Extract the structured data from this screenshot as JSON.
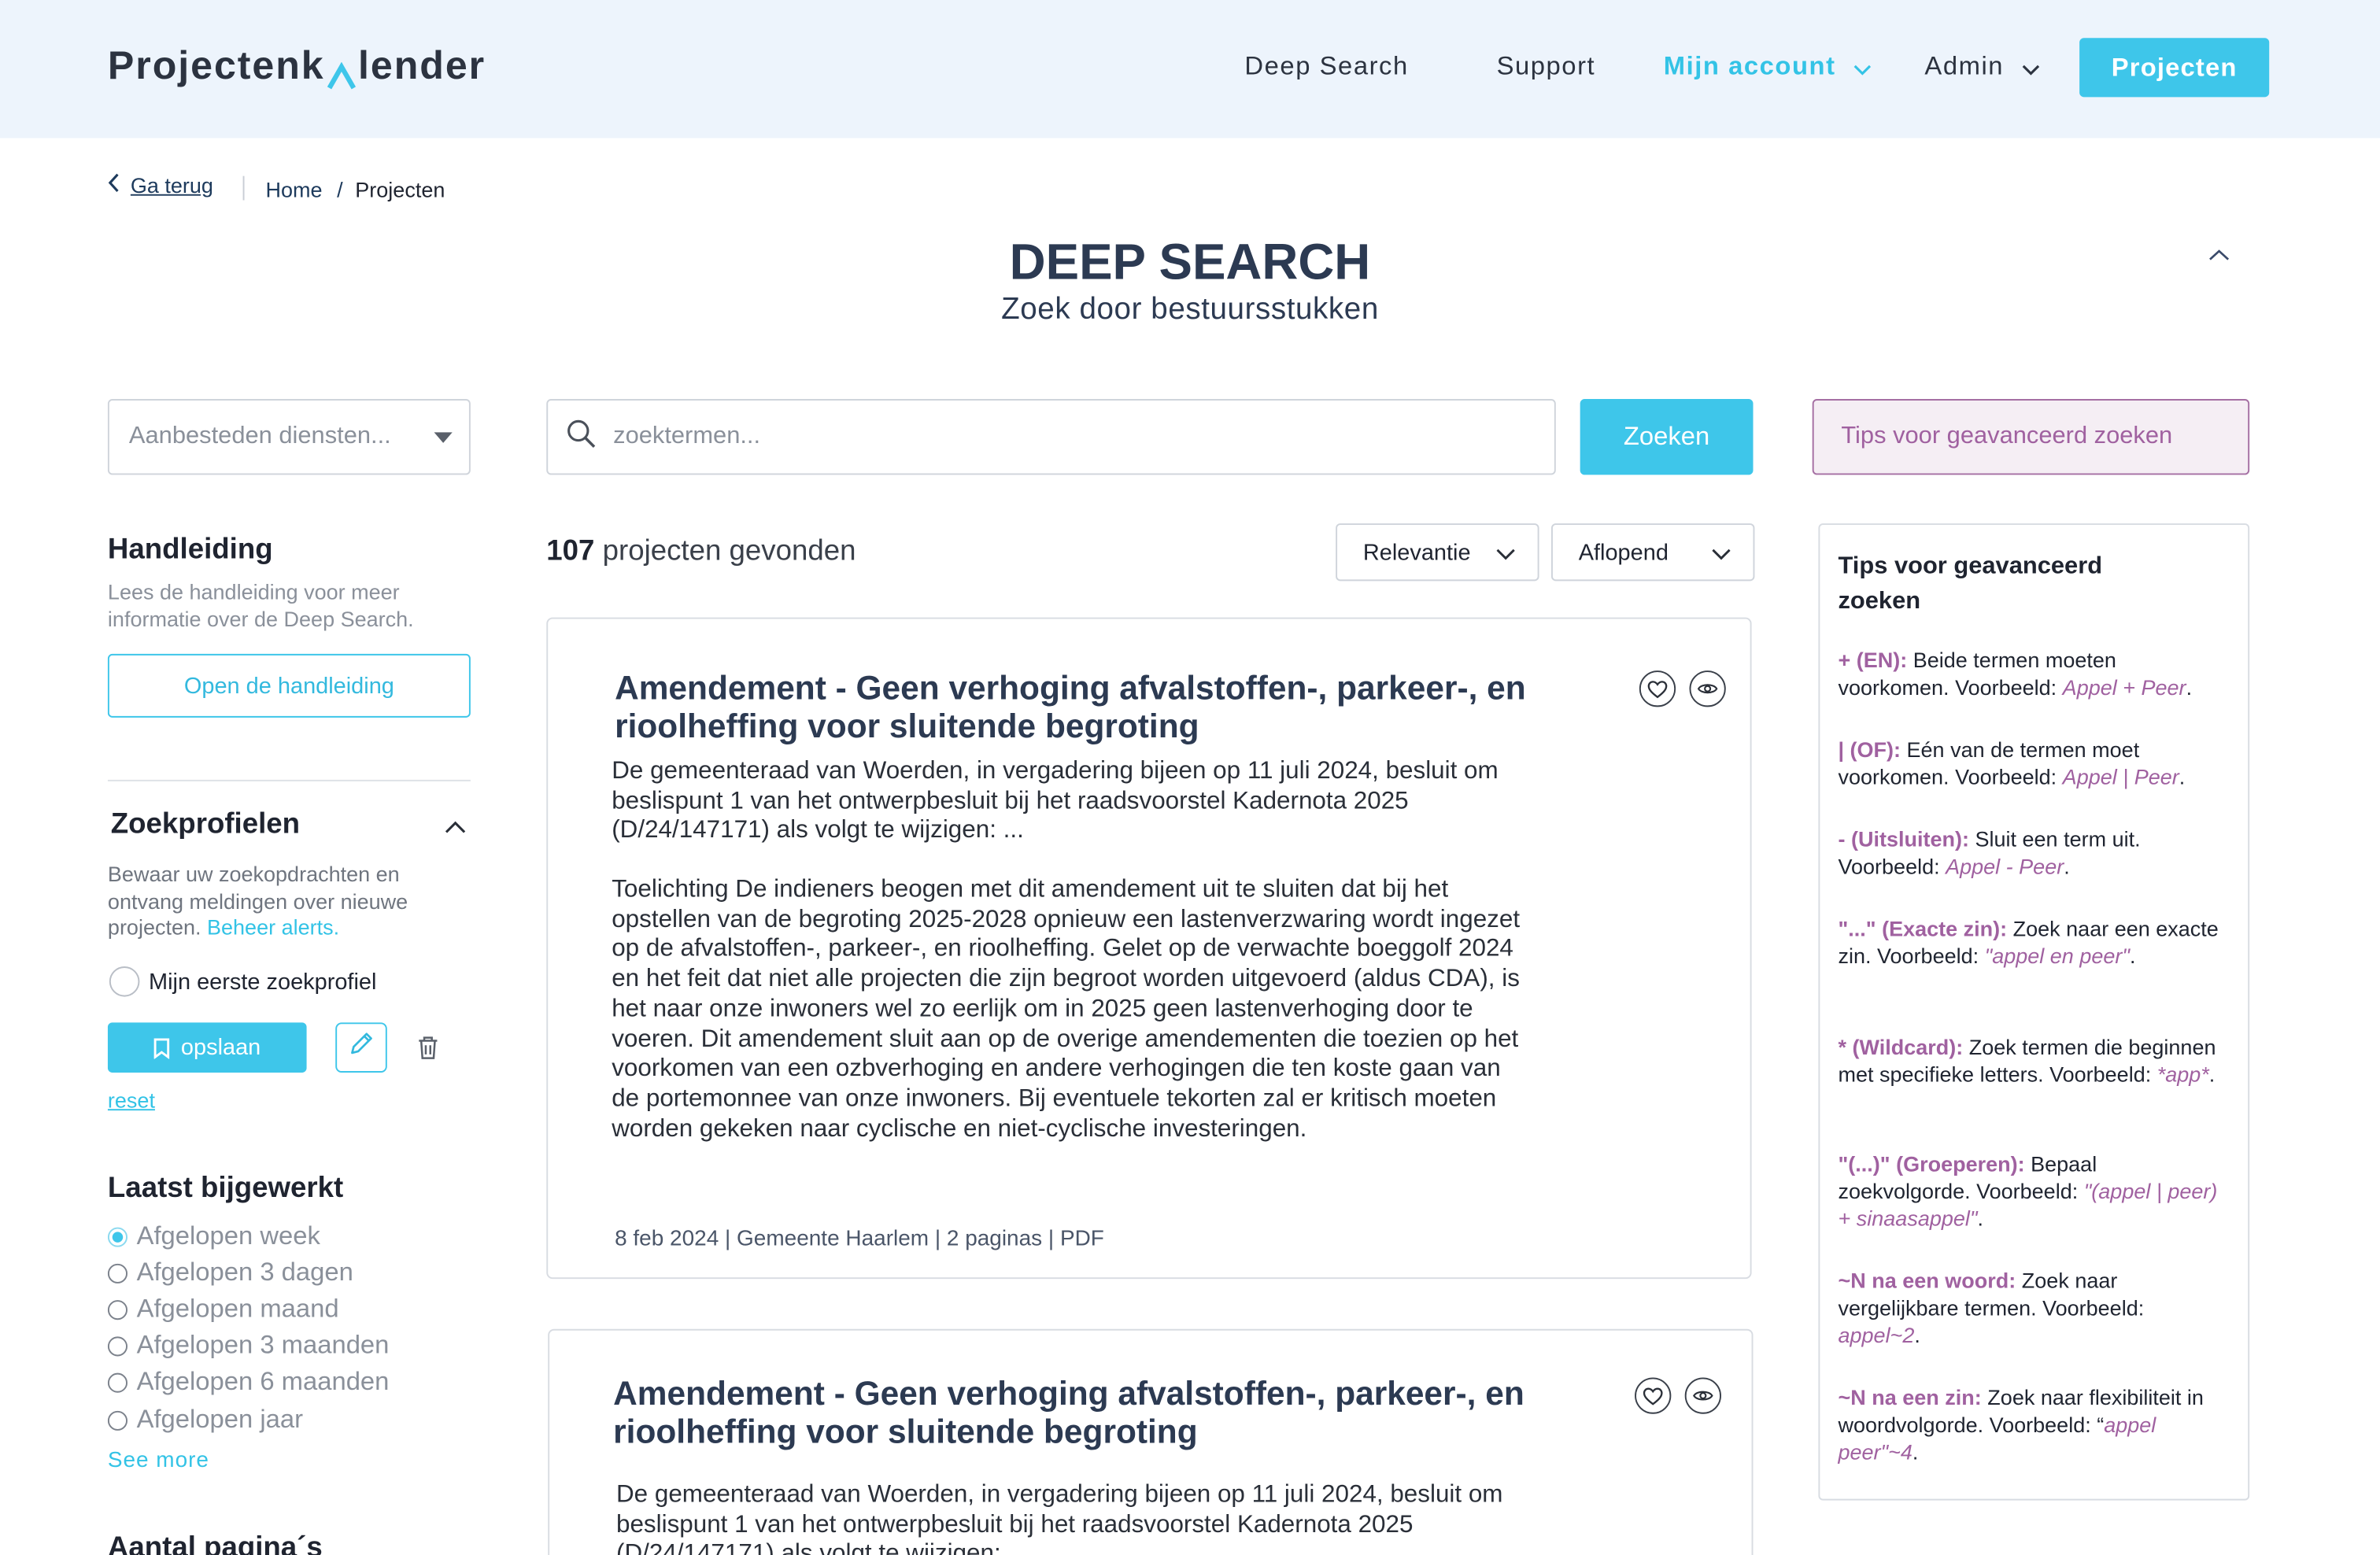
{
  "header": {
    "logo_pre": "Projectenk",
    "logo_post": "lender",
    "nav": [
      "Deep Search",
      "Support",
      "Mijn account",
      "Admin"
    ],
    "cta": "Projecten",
    "accent": "#3ec6ea"
  },
  "breadcrumb": {
    "back": "Ga terug",
    "home": "Home",
    "separator": "/",
    "current": "Projecten"
  },
  "page": {
    "title": "DEEP SEARCH",
    "subtitle": "Zoek door bestuursstukken"
  },
  "filter": {
    "select_value": "Aanbesteden diensten..."
  },
  "search": {
    "placeholder": "zoektermen...",
    "button": "Zoeken",
    "tips_button": "Tips voor geavanceerd zoeken"
  },
  "sidebar": {
    "manual": {
      "title": "Handleiding",
      "text": "Lees de handleiding voor meer informatie over de Deep Search.",
      "button": "Open de handleiding"
    },
    "profiles": {
      "title": "Zoekprofielen",
      "text": "Bewaar uw zoekopdrachten en ontvang meldingen over nieuwe projecten.",
      "link": "Beheer alerts.",
      "profile_name": "Mijn eerste zoekprofiel",
      "save": "opslaan",
      "reset": "reset"
    },
    "updated": {
      "title": "Laatst bijgewerkt",
      "options": [
        "Afgelopen week",
        "Afgelopen 3 dagen",
        "Afgelopen maand",
        "Afgelopen 3 maanden",
        "Afgelopen 6 maanden",
        "Afgelopen jaar"
      ],
      "selected": "Afgelopen week",
      "see_more": "See more"
    },
    "pages_title": "Aantal pagina´s"
  },
  "results": {
    "count": "107",
    "count_label": " projecten gevonden",
    "sort": "Relevantie",
    "order": "Aflopend",
    "items": [
      {
        "title": "Amendement - Geen verhoging afvalstoffen-, parkeer-, en rioolheffing voor sluitende begroting",
        "intro": "De gemeenteraad van Woerden, in vergadering bijeen op 11 juli 2024, besluit om beslispunt 1 van het ontwerpbesluit bij het raadsvoorstel Kadernota 2025 (D/24/147171) als volgt te wijzigen: ...",
        "body": "Toelichting De indieners beogen met dit amendement uit te sluiten dat bij het opstellen van de begroting 2025-2028 opnieuw een lastenverzwaring wordt ingezet op de afvalstoffen-, parkeer-, en rioolheffing. Gelet op de verwachte boeggolf 2024 en het feit dat niet alle projecten die zijn begroot worden uitgevoerd (aldus CDA), is het naar onze inwoners wel zo eerlijk om in 2025 geen lastenverhoging door te voeren. Dit amendement sluit aan op de overige amendementen die toezien op het voorkomen van een ozbverhoging en andere verhogingen die ten koste gaan van de portemonnee van onze inwoners. Bij eventuele tekorten zal er kritisch moeten worden gekeken naar cyclische en niet-cyclische investeringen.",
        "meta": "8 feb 2024 | Gemeente Haarlem | 2 paginas | PDF"
      },
      {
        "title": "Amendement - Geen verhoging afvalstoffen-, parkeer-, en rioolheffing voor sluitende begroting",
        "intro": "De gemeenteraad van Woerden, in vergadering bijeen op 11 juli 2024, besluit om beslispunt 1 van het ontwerpbesluit bij het raadsvoorstel Kadernota 2025 (D/24/147171) als volgt te wijzigen: ..."
      }
    ]
  },
  "tips": {
    "title": "Tips voor geavanceerd zoeken",
    "items": [
      {
        "key": "+ (EN):",
        "text": " Beide termen moeten voorkomen. Voorbeeld: ",
        "example": "Appel + Peer",
        "end": "."
      },
      {
        "key": "| (OF):",
        "text": " Eén van de termen moet voorkomen. Voorbeeld: ",
        "example": "Appel | Peer",
        "end": "."
      },
      {
        "key": "- (Uitsluiten):",
        "text": " Sluit een term uit. Voorbeeld: ",
        "example": "Appel - Peer",
        "end": "."
      },
      {
        "key": " \"...\" (Exacte zin):",
        "text": " Zoek naar een exacte zin. Voorbeeld: ",
        "example": "\"appel en peer\"",
        "end": "."
      },
      {
        "key": " * (Wildcard):",
        "text": " Zoek termen die beginnen met specifieke letters. Voorbeeld: ",
        "example": "*app*",
        "end": "."
      },
      {
        "key": " \"(...)\" (Groeperen):",
        "text": " Bepaal zoekvolgorde. Voorbeeld: ",
        "example": "\"(appel | peer) + sinaasappel\"",
        "end": "."
      },
      {
        "key": " ~N na een woord:",
        "text": " Zoek naar vergelijkbare termen. Voorbeeld: ",
        "example": "appel~2",
        "end": "."
      },
      {
        "key": " ~N na een zin:",
        "text": " Zoek naar flexibiliteit in woordvolgorde. Voorbeeld: “",
        "example": "appel peer\"~4",
        "end": "."
      }
    ]
  }
}
